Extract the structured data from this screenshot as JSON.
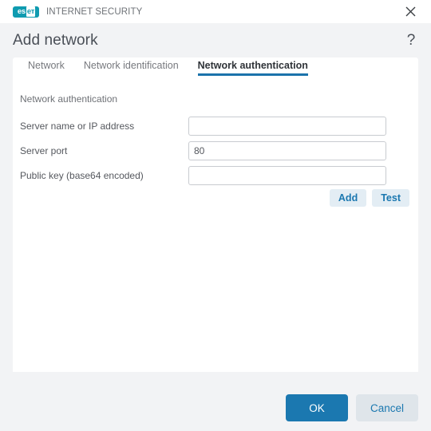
{
  "window": {
    "brand_name": "INTERNET SECURITY",
    "logo_text_left": "es",
    "logo_text_right": "eт",
    "logo_icon": "eset-logo",
    "close_icon": "close-icon"
  },
  "dialog": {
    "title": "Add network",
    "help_icon": "question-mark-icon",
    "help_label": "?"
  },
  "tabs": [
    {
      "label": "Network",
      "active": false
    },
    {
      "label": "Network identification",
      "active": false
    },
    {
      "label": "Network authentication",
      "active": true
    }
  ],
  "form": {
    "section_label": "Network authentication",
    "fields": [
      {
        "label": "Server name or IP address",
        "value": "",
        "placeholder": ""
      },
      {
        "label": "Server port",
        "value": "80",
        "placeholder": ""
      },
      {
        "label": "Public key (base64 encoded)",
        "value": "",
        "placeholder": ""
      }
    ],
    "actions": [
      {
        "label": "Add"
      },
      {
        "label": "Test"
      }
    ]
  },
  "footer": {
    "ok_label": "OK",
    "cancel_label": "Cancel"
  },
  "colors": {
    "accent_blue": "#1b78b0",
    "tab_underline": "#1b73ab",
    "brand_teal": "#0f9bb0",
    "body_bg": "#f2f3f5"
  }
}
